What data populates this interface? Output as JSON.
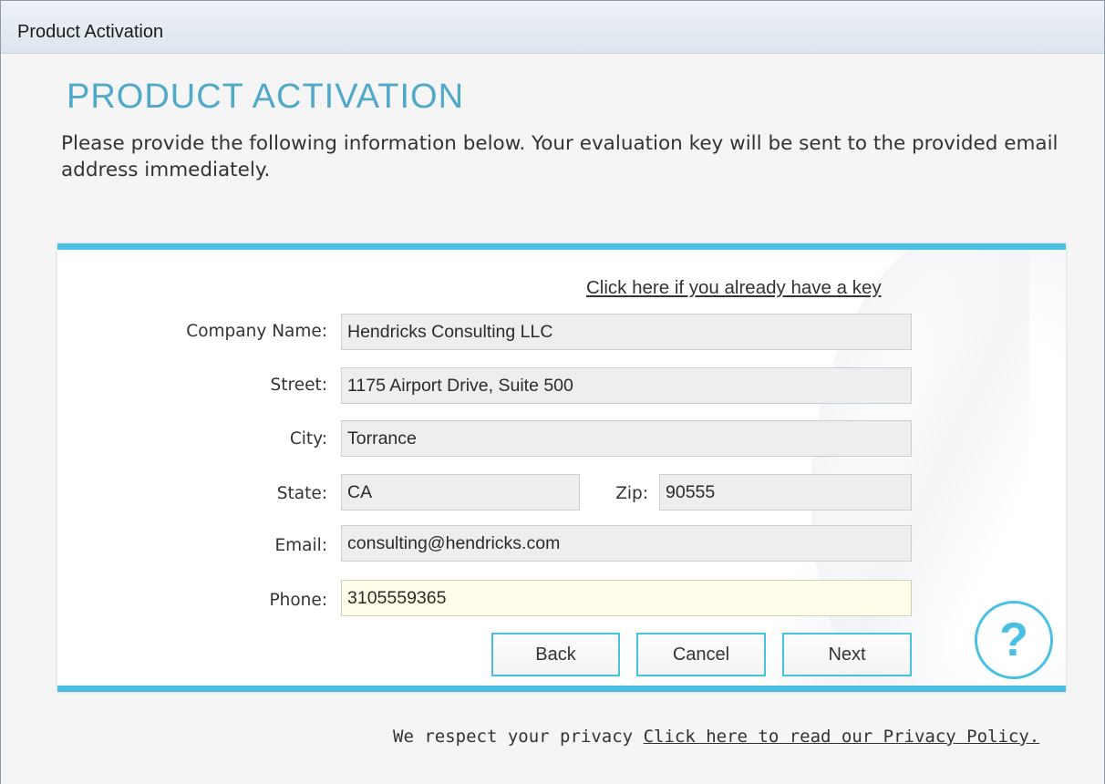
{
  "window": {
    "title": "Product Activation"
  },
  "heading": "PRODUCT ACTIVATION",
  "intro": "Please provide the following information below. Your evaluation key will be sent to the provided email address immediately.",
  "key_link": "Click here if you already have a key",
  "form": {
    "company_label": "Company Name:",
    "company_value": "Hendricks Consulting LLC",
    "street_label": "Street:",
    "street_value": "1175 Airport Drive, Suite 500",
    "city_label": "City:",
    "city_value": "Torrance",
    "state_label": "State:",
    "state_value": "CA",
    "zip_label": "Zip:",
    "zip_value": "90555",
    "email_label": "Email:",
    "email_value": "consulting@hendricks.com",
    "phone_label": "Phone:",
    "phone_value": "3105559365"
  },
  "buttons": {
    "back": "Back",
    "cancel": "Cancel",
    "next": "Next"
  },
  "help_glyph": "?",
  "footer": {
    "text": "We respect your privacy",
    "link": "Click here to read our Privacy Policy."
  },
  "colors": {
    "accent": "#49c0e3",
    "heading": "#4fa9c9",
    "active_field": "#fffdea"
  }
}
